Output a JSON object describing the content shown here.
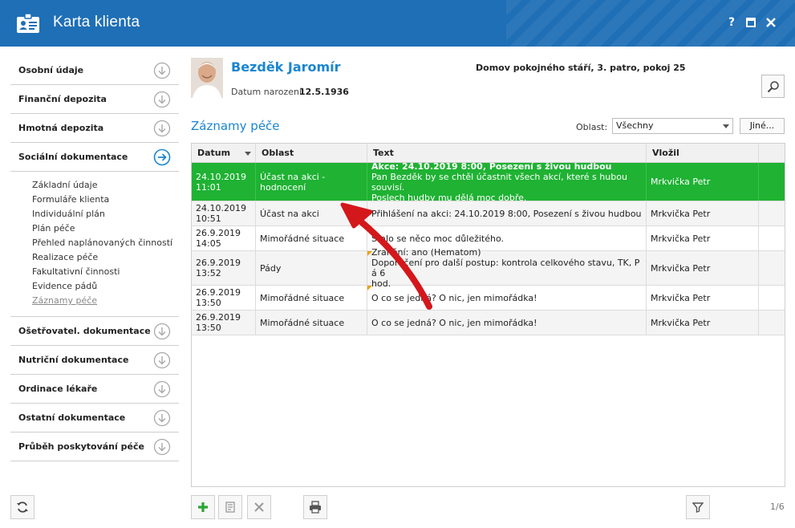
{
  "window": {
    "title": "Karta klienta",
    "help_label": "?",
    "colors": {
      "titlebar": "#1f6fb6",
      "accent": "#1a86d0",
      "selected_row": "#1fb233",
      "annotation": "#d4171b"
    }
  },
  "sidebar": {
    "sections": [
      {
        "label": "Osobní údaje"
      },
      {
        "label": "Finanční depozita"
      },
      {
        "label": "Hmotná depozita"
      },
      {
        "label": "Sociální dokumentace",
        "expanded": true
      }
    ],
    "subitems": [
      "Základní údaje",
      "Formuláře klienta",
      "Individuální plán",
      "Plán péče",
      "Přehled naplánovaných činností",
      "Realizace péče",
      "Fakultativní činnosti",
      "Evidence pádů",
      "Záznamy péče"
    ],
    "sections_after": [
      {
        "label": "Ošetřovatel. dokumentace"
      },
      {
        "label": "Nutriční dokumentace"
      },
      {
        "label": "Ordinace lékaře"
      },
      {
        "label": "Ostatní dokumentace"
      },
      {
        "label": "Průběh poskytování péče"
      }
    ]
  },
  "client": {
    "name": "Bezděk Jaromír",
    "dob_label": "Datum narození:",
    "dob": "12.5.1936",
    "location": "Domov pokojného stáří, 3. patro, pokoj 25"
  },
  "records": {
    "title": "Záznamy péče",
    "filter_label": "Oblast:",
    "filter_value": "Všechny",
    "other_button": "Jiné...",
    "columns": [
      "Datum",
      "Oblast",
      "Text",
      "Vložil"
    ],
    "rows": [
      {
        "date": "24.10.2019",
        "time": "11:01",
        "area": "Účast na akci - hodnocení",
        "text_bold": "Akce: 24.10.2019 8:00, Posezení s živou hudbou",
        "text": [
          "Pan Bezděk by se chtěl účastnit všech akcí, které s hubou souvisí.",
          "Poslech hudby mu dělá moc dobře."
        ],
        "author": "Mrkvička Petr",
        "selected": true
      },
      {
        "date": "24.10.2019",
        "time": "10:51",
        "area": "Účast na akci",
        "text": [
          "Přihlášení na akci: 24.10.2019 8:00, Posezení s živou hudbou"
        ],
        "author": "Mrkvička Petr"
      },
      {
        "date": "26.9.2019",
        "time": "14:05",
        "area": "Mimořádné situace",
        "text": [
          "Stalo se něco moc důležitého."
        ],
        "author": "Mrkvička Petr",
        "flag": true
      },
      {
        "date": "26.9.2019",
        "time": "13:52",
        "area": "Pády",
        "text": [
          "Zranění: ano (Hematom)",
          "Doporučení pro další postup: kontrola celkového stavu, TK, P á 6",
          "hod."
        ],
        "author": "Mrkvička Petr",
        "flag": true
      },
      {
        "date": "26.9.2019",
        "time": "13:50",
        "area": "Mimořádné situace",
        "text": [
          "O co se jedná? O nic, jen mimořádka!"
        ],
        "author": "Mrkvička Petr",
        "flag": true
      },
      {
        "date": "26.9.2019",
        "time": "13:50",
        "area": "Mimořádné situace",
        "text": [
          "O co se jedná? O nic, jen mimořádka!"
        ],
        "author": "Mrkvička Petr"
      }
    ],
    "pager": "1/6"
  }
}
